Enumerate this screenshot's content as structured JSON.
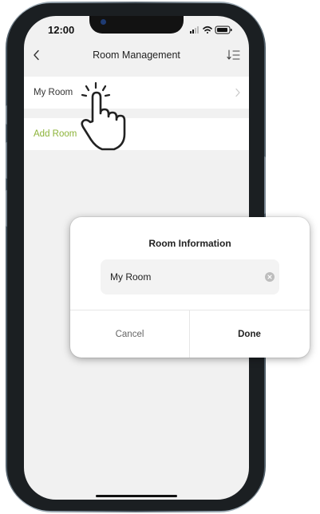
{
  "status_bar": {
    "time": "12:00"
  },
  "nav": {
    "title": "Room Management",
    "back_icon": "chevron-left-icon",
    "sort_icon": "sort-list-icon"
  },
  "list": {
    "rooms": [
      {
        "label": "My Room"
      }
    ],
    "add_label": "Add Room"
  },
  "dialog": {
    "title": "Room Information",
    "input_value": "My Room",
    "cancel_label": "Cancel",
    "done_label": "Done"
  },
  "colors": {
    "accent_green": "#8cb339",
    "screen_bg": "#f1f1f1"
  }
}
